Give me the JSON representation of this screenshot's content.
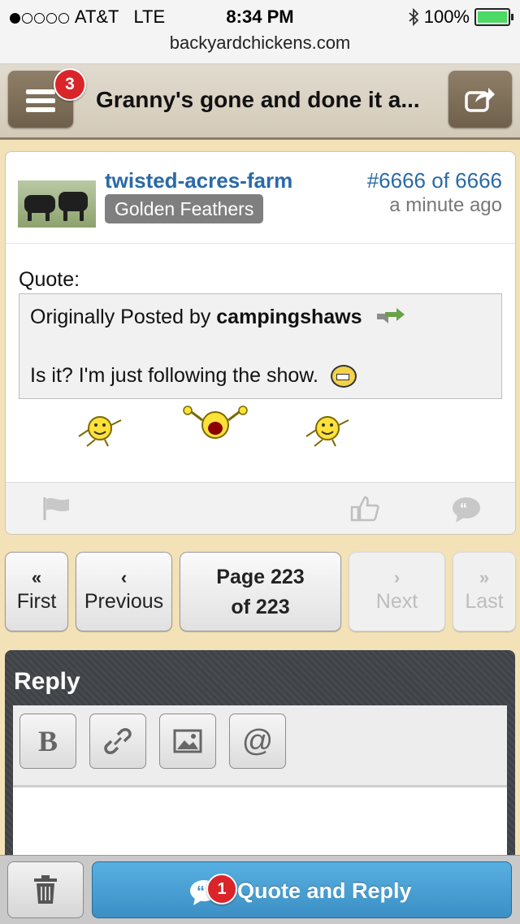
{
  "status_bar": {
    "carrier": "AT&T",
    "network": "LTE",
    "time": "8:34 PM",
    "battery": "100%",
    "url": "backyardchickens.com"
  },
  "header": {
    "menu_badge": "3",
    "title": "Granny's gone and done it a..."
  },
  "post": {
    "username": "twisted-acres-farm",
    "rank": "Golden Feathers",
    "post_number": "#6666 of 6666",
    "time": "a minute ago",
    "quote_label": "Quote:",
    "quote_prefix": "Originally Posted by",
    "quote_author": "campingshaws",
    "quote_text": "Is it? I'm just following the show."
  },
  "pagination": {
    "first": "First",
    "previous": "Previous",
    "page_line1": "Page 223",
    "page_line2": "of 223",
    "next": "Next",
    "last": "Last"
  },
  "reply": {
    "title": "Reply"
  },
  "bottom": {
    "quote_reply_label": "Quote and Reply",
    "quote_reply_badge": "1"
  }
}
